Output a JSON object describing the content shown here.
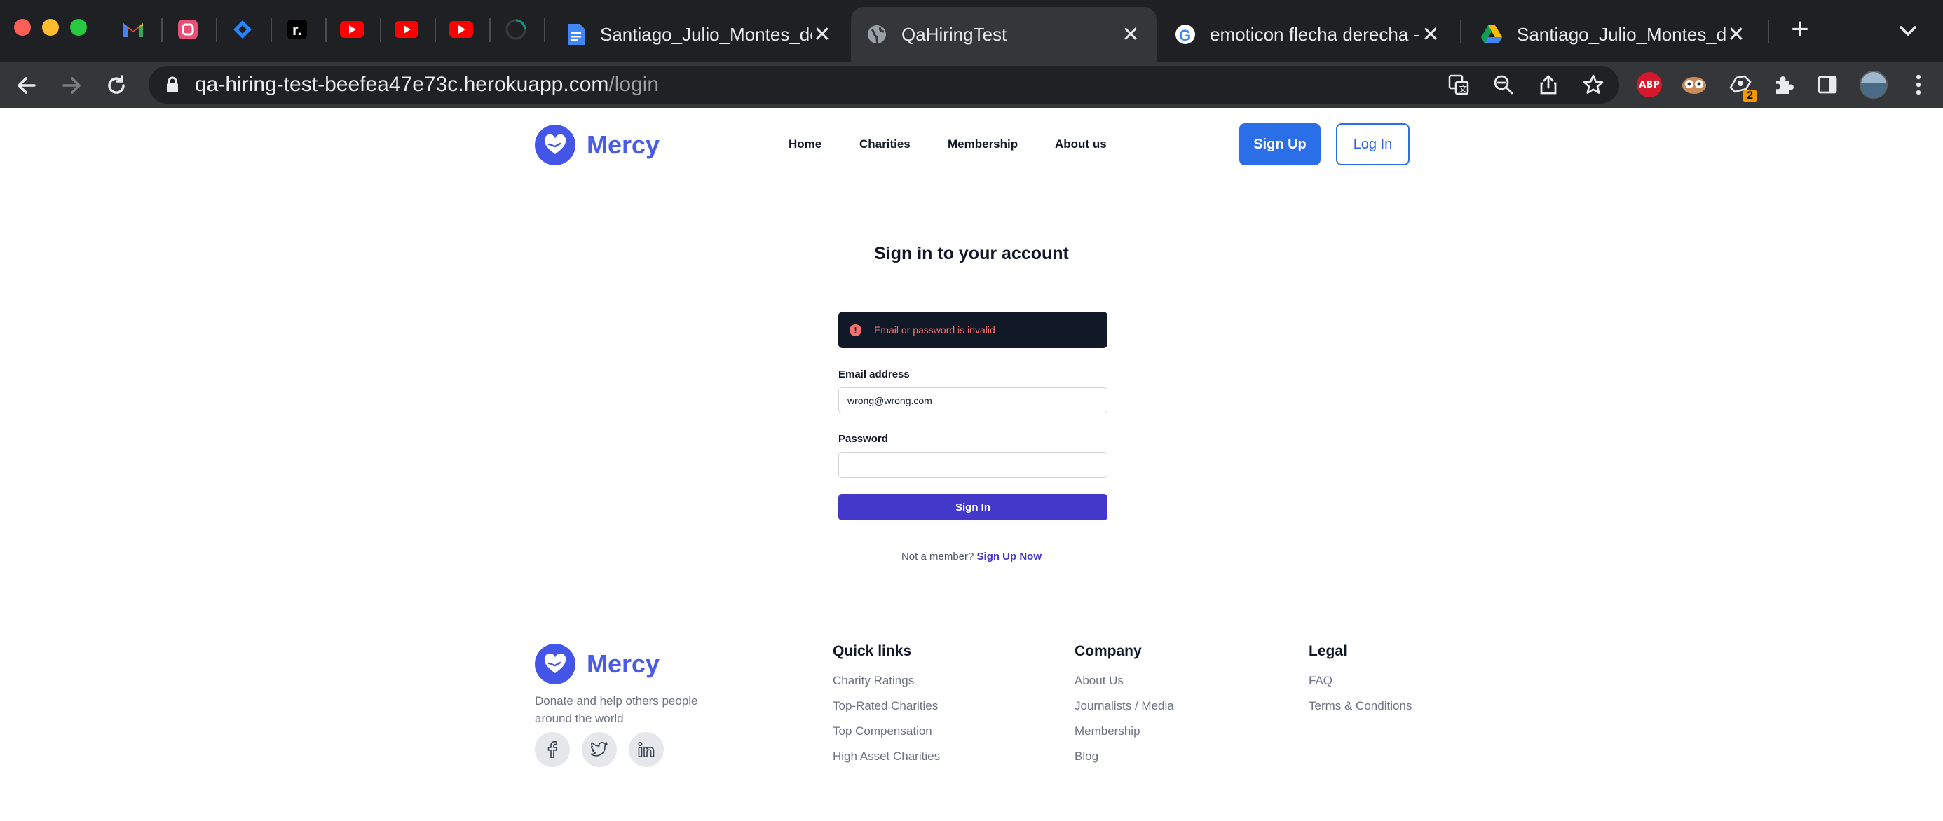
{
  "browser": {
    "pinned_tabs": [
      {
        "icon": "gmail-icon"
      },
      {
        "icon": "app-icon"
      },
      {
        "icon": "jira-icon"
      },
      {
        "icon": "r-icon"
      },
      {
        "icon": "youtube-icon"
      },
      {
        "icon": "youtube-icon"
      },
      {
        "icon": "youtube-icon"
      },
      {
        "icon": "loading-icon"
      }
    ],
    "tabs": [
      {
        "title": "Santiago_Julio_Montes_de",
        "icon": "docs-icon",
        "active": false
      },
      {
        "title": "QaHiringTest",
        "icon": "globe-icon",
        "active": true
      },
      {
        "title": "emoticon flecha derecha -",
        "icon": "google-icon",
        "active": false
      },
      {
        "title": "Santiago_Julio_Montes_de",
        "icon": "drive-icon",
        "active": false
      }
    ],
    "url_host": "qa-hiring-test-beefea47e73c.herokuapp.com",
    "url_path": "/login",
    "extension_badge": "2",
    "abp_label": "ABP"
  },
  "header": {
    "brand": "Mercy",
    "nav": [
      "Home",
      "Charities",
      "Membership",
      "About us"
    ],
    "signup_label": "Sign Up",
    "login_label": "Log In"
  },
  "login_form": {
    "title": "Sign in to your account",
    "error": "Email or password is invalid",
    "email_label": "Email address",
    "email_value": "wrong@wrong.com",
    "password_label": "Password",
    "password_value": "",
    "submit_label": "Sign In",
    "member_prompt": "Not a member?",
    "member_link": "Sign Up Now"
  },
  "footer": {
    "brand": "Mercy",
    "tagline": "Donate and help others people around the world",
    "social": [
      "facebook-icon",
      "twitter-icon",
      "linkedin-icon"
    ],
    "columns": [
      {
        "title": "Quick links",
        "links": [
          "Charity Ratings",
          "Top-Rated Charities",
          "Top Compensation",
          "High Asset Charities"
        ]
      },
      {
        "title": "Company",
        "links": [
          "About Us",
          "Journalists / Media",
          "Membership",
          "Blog"
        ]
      },
      {
        "title": "Legal",
        "links": [
          "FAQ",
          "Terms & Conditions"
        ]
      }
    ]
  },
  "colors": {
    "brand": "#4a5ce6",
    "primary_button": "#2b6fe8",
    "signin_button": "#4338ca",
    "alert_bg": "#111827",
    "alert_text": "#f87171"
  }
}
